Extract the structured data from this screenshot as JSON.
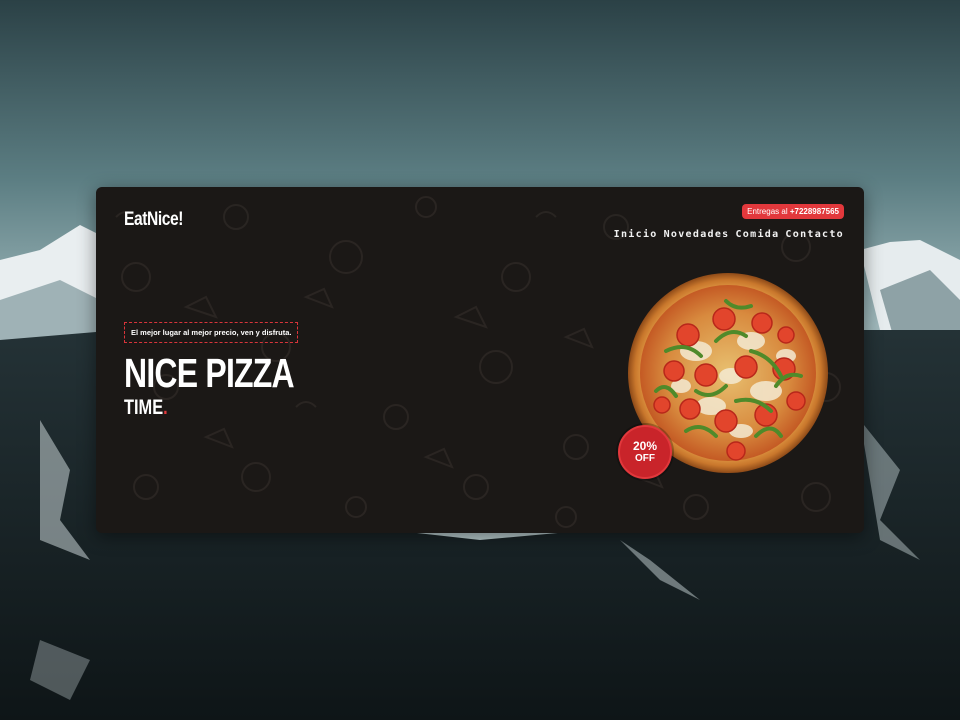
{
  "brand": {
    "logo": "EatNice!"
  },
  "delivery": {
    "label": "Entregas al ",
    "phone": "+7228987565"
  },
  "nav": {
    "items": [
      "Inicio",
      "Novedades",
      "Comida",
      "Contacto"
    ]
  },
  "hero": {
    "tagline": "El mejor lugar al mejor precio, ven y disfruta.",
    "title": "NICE PIZZA",
    "subtitle": "TIME",
    "subtitle_dot": "."
  },
  "badge": {
    "percent": "20%",
    "label": "OFF"
  },
  "colors": {
    "accent": "#e2383c",
    "card_bg": "#1b1816",
    "text": "#ffffff"
  }
}
